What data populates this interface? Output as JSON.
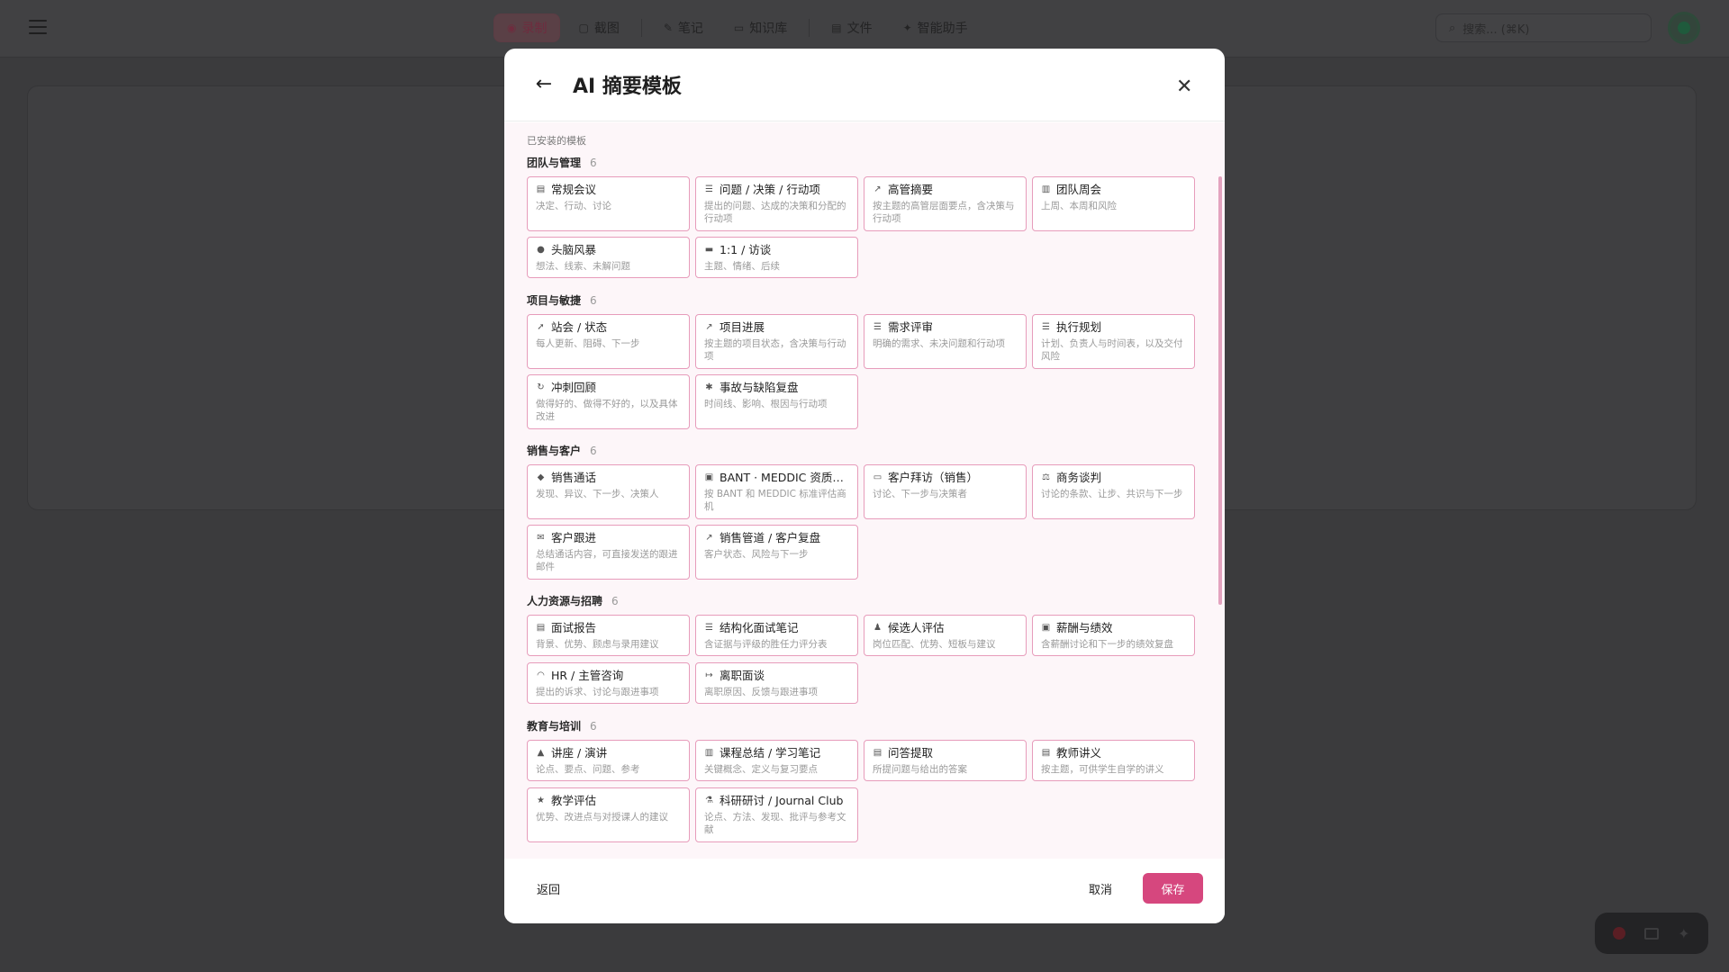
{
  "background": {
    "nav": [
      {
        "icon": "record-icon",
        "glyph": "◉",
        "label": "录制",
        "active": true
      },
      {
        "icon": "screenshot-icon",
        "glyph": "▢",
        "label": "截图"
      },
      {
        "icon": "notes-icon",
        "glyph": "✎",
        "label": "笔记"
      },
      {
        "icon": "knowledge-icon",
        "glyph": "▭",
        "label": "知识库"
      },
      {
        "icon": "files-icon",
        "glyph": "▤",
        "label": "文件"
      },
      {
        "icon": "assistant-icon",
        "glyph": "✦",
        "label": "智能助手"
      }
    ],
    "search_placeholder": "搜索... (⌘K)"
  },
  "modal": {
    "title": "AI 摘要模板",
    "installed_label": "已安装的模板",
    "footer": {
      "return_label": "返回",
      "cancel_label": "取消",
      "save_label": "保存"
    },
    "colors": {
      "accent": "#d6477e",
      "card_border": "#e79cbb",
      "body_bg": "#fdf6f9"
    },
    "sections": [
      {
        "title": "团队与管理",
        "count": "6",
        "cards": [
          {
            "icon": "document-icon",
            "glyph": "▤",
            "title": "常规会议",
            "desc": "决定、行动、讨论"
          },
          {
            "icon": "checklist-icon",
            "glyph": "☰",
            "title": "问题 / 决策 / 行动项",
            "desc": "提出的问题、达成的决策和分配的行动项"
          },
          {
            "icon": "trend-icon",
            "glyph": "↗",
            "title": "高管摘要",
            "desc": "按主题的高管层面要点，含决策与行动项"
          },
          {
            "icon": "bars-icon",
            "glyph": "▥",
            "title": "团队周会",
            "desc": "上周、本周和风险"
          },
          {
            "icon": "bulb-icon",
            "glyph": "●",
            "title": "头脑风暴",
            "desc": "想法、线索、未解问题"
          },
          {
            "icon": "chat-icon",
            "glyph": "▬",
            "title": "1:1 / 访谈",
            "desc": "主题、情绪、后续"
          }
        ]
      },
      {
        "title": "项目与敏捷",
        "count": "6",
        "cards": [
          {
            "icon": "rocket-icon",
            "glyph": "➚",
            "title": "站会 / 状态",
            "desc": "每人更新、阻碍、下一步"
          },
          {
            "icon": "trend-icon",
            "glyph": "↗",
            "title": "项目进展",
            "desc": "按主题的项目状态，含决策与行动项"
          },
          {
            "icon": "checklist-icon",
            "glyph": "☰",
            "title": "需求评审",
            "desc": "明确的需求、未决问题和行动项"
          },
          {
            "icon": "checklist-icon",
            "glyph": "☰",
            "title": "执行规划",
            "desc": "计划、负责人与时间表，以及交付风险"
          },
          {
            "icon": "refresh-icon",
            "glyph": "↻",
            "title": "冲刺回顾",
            "desc": "做得好的、做得不好的，以及具体改进"
          },
          {
            "icon": "bug-icon",
            "glyph": "✱",
            "title": "事故与缺陷复盘",
            "desc": "时间线、影响、根因与行动项"
          }
        ]
      },
      {
        "title": "销售与客户",
        "count": "6",
        "cards": [
          {
            "icon": "gem-icon",
            "glyph": "◆",
            "title": "销售通话",
            "desc": "发现、异议、下一步、决策人"
          },
          {
            "icon": "clipboard-icon",
            "glyph": "▣",
            "title": "BANT · MEDDIC 资质…",
            "desc": "按 BANT 和 MEDDIC 标准评估商机"
          },
          {
            "icon": "car-icon",
            "glyph": "▭",
            "title": "客户拜访（销售）",
            "desc": "讨论、下一步与决策者"
          },
          {
            "icon": "scale-icon",
            "glyph": "⚖",
            "title": "商务谈判",
            "desc": "讨论的条款、让步、共识与下一步"
          },
          {
            "icon": "mail-icon",
            "glyph": "✉",
            "title": "客户跟进",
            "desc": "总结通话内容，可直接发送的跟进邮件"
          },
          {
            "icon": "chart-icon",
            "glyph": "↗",
            "title": "销售管道 / 客户复盘",
            "desc": "客户状态、风险与下一步"
          }
        ]
      },
      {
        "title": "人力资源与招聘",
        "count": "6",
        "cards": [
          {
            "icon": "document-icon",
            "glyph": "▤",
            "title": "面试报告",
            "desc": "背景、优势、顾虑与录用建议"
          },
          {
            "icon": "checklist-icon",
            "glyph": "☰",
            "title": "结构化面试笔记",
            "desc": "含证据与评级的胜任力评分表"
          },
          {
            "icon": "user-check-icon",
            "glyph": "♟",
            "title": "候选人评估",
            "desc": "岗位匹配、优势、短板与建议"
          },
          {
            "icon": "money-icon",
            "glyph": "▣",
            "title": "薪酬与绩效",
            "desc": "含薪酬讨论和下一步的绩效复盘"
          },
          {
            "icon": "headset-icon",
            "glyph": "◠",
            "title": "HR / 主管咨询",
            "desc": "提出的诉求、讨论与跟进事项"
          },
          {
            "icon": "logout-icon",
            "glyph": "↦",
            "title": "离职面谈",
            "desc": "离职原因、反馈与跟进事项"
          }
        ]
      },
      {
        "title": "教育与培训",
        "count": "6",
        "cards": [
          {
            "icon": "graduation-icon",
            "glyph": "▲",
            "title": "讲座 / 演讲",
            "desc": "论点、要点、问题、参考"
          },
          {
            "icon": "book-icon",
            "glyph": "▥",
            "title": "课程总结 / 学习笔记",
            "desc": "关键概念、定义与复习要点"
          },
          {
            "icon": "qa-icon",
            "glyph": "▤",
            "title": "问答提取",
            "desc": "所提问题与给出的答案"
          },
          {
            "icon": "document-icon",
            "glyph": "▤",
            "title": "教师讲义",
            "desc": "按主题，可供学生自学的讲义"
          },
          {
            "icon": "star-icon",
            "glyph": "★",
            "title": "教学评估",
            "desc": "优势、改进点与对授课人的建议"
          },
          {
            "icon": "flask-icon",
            "glyph": "⚗",
            "title": "科研研讨 / Journal Club",
            "desc": "论点、方法、发现、批评与参考文献"
          }
        ]
      }
    ]
  }
}
